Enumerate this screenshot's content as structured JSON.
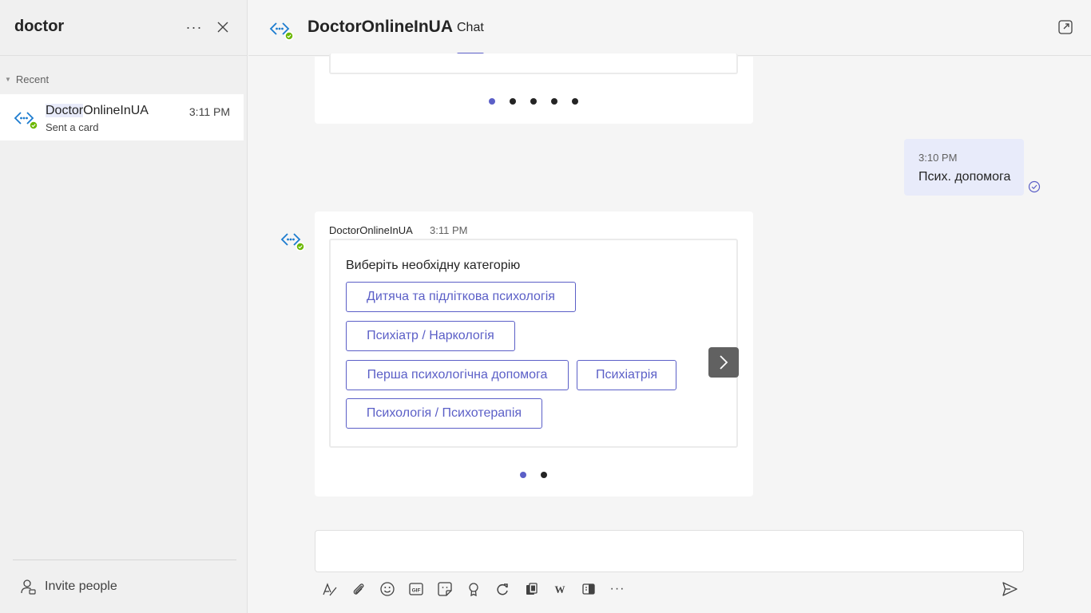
{
  "left_pane": {
    "search_query": "doctor",
    "section_label": "Recent",
    "conversation": {
      "name_highlight": "Doctor",
      "name_rest": "OnlineInUA",
      "preview": "Sent a card",
      "time": "3:11 PM"
    },
    "invite_label": "Invite people"
  },
  "header": {
    "bot_name": "DoctorOnlineInUA",
    "tab_chat": "Chat"
  },
  "messages": {
    "sent": {
      "time": "3:10 PM",
      "text": "Псих. допомога"
    },
    "bot_card": {
      "sender": "DoctorOnlineInUA",
      "time": "3:11 PM",
      "prompt": "Виберіть необхідну категорію",
      "options": [
        "Дитяча та підліткова психологія",
        "Психіатр / Наркологія",
        "Перша психологічна допомога",
        "Психіатрія",
        "Психологія / Психотерапія"
      ]
    },
    "prev_carousel": {
      "pages": 5,
      "active_index": 0
    },
    "card_carousel": {
      "pages": 2,
      "active_index": 0
    }
  },
  "colors": {
    "accent": "#5b5fc7",
    "online": "#6bb700",
    "bot_blue": "#1c7ccf"
  },
  "icons": {
    "toolbar": [
      "format-icon",
      "attach-icon",
      "emoji-icon",
      "gif-icon",
      "sticker-icon",
      "praise-icon",
      "loop-icon",
      "stream-icon",
      "wiki-icon",
      "whiteboard-icon",
      "more-icon"
    ]
  }
}
